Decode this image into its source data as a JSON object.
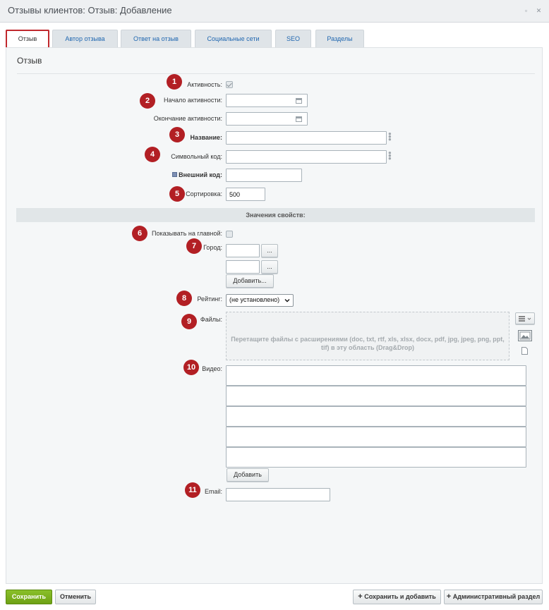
{
  "window": {
    "title": "Отзывы клиентов: Отзыв: Добавление"
  },
  "tabs": [
    {
      "label": "Отзыв"
    },
    {
      "label": "Автор отзыва"
    },
    {
      "label": "Ответ на отзыв"
    },
    {
      "label": "Социальные сети"
    },
    {
      "label": "SEO"
    },
    {
      "label": "Разделы"
    }
  ],
  "panel": {
    "heading": "Отзыв"
  },
  "form": {
    "activity_label": "Активность:",
    "active_from_label": "Начало активности:",
    "active_to_label": "Окончание активности:",
    "name_label": "Название:",
    "code_label": "Символьный код:",
    "external_code_label": "Внешний код:",
    "sort_label": "Сортировка:",
    "sort_value": "500",
    "properties_header": "Значения свойств:",
    "show_on_main_label": "Показывать на главной:",
    "city_label": "Город:",
    "city_browse_label": "...",
    "city_add_label": "Добавить...",
    "rating_label": "Рейтинг:",
    "rating_selected": "(не установлено)",
    "files_label": "Файлы:",
    "files_drop_text": "Перетащите файлы с расширениями (doc, txt, rtf, xls, xlsx, docx, pdf, jpg, jpeg, png, ppt, tif) в эту область (Drag&Drop)",
    "video_label": "Видео:",
    "video_add_label": "Добавить",
    "email_label": "Email:"
  },
  "badges": [
    "1",
    "2",
    "3",
    "4",
    "5",
    "6",
    "7",
    "8",
    "9",
    "10",
    "11"
  ],
  "footer": {
    "save": "Сохранить",
    "cancel": "Отменить",
    "save_and_add": "Сохранить и добавить",
    "admin_section": "Административный раздел"
  },
  "colors": {
    "badge": "#b21f24",
    "active_tab_border": "#c0282d",
    "tab_text": "#2067b0",
    "save_button": "#7bb01f"
  }
}
